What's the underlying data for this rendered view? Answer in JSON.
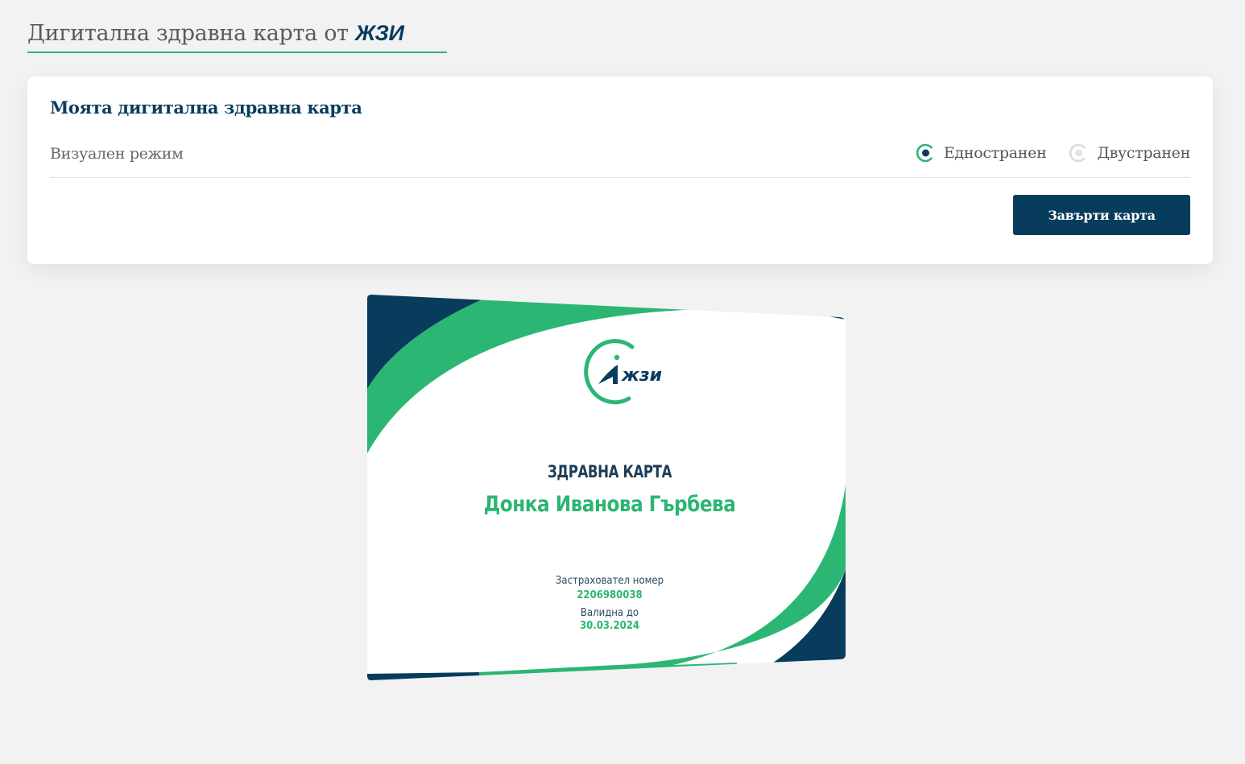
{
  "header": {
    "title": "Дигитална здравна карта от",
    "brand": "ЖЗИ"
  },
  "panel": {
    "title": "Моята дигитална здравна карта",
    "mode_label": "Визуален режим",
    "options": [
      {
        "label": "Едностранен",
        "selected": true
      },
      {
        "label": "Двустранен",
        "selected": false
      }
    ],
    "rotate_button": "Завърти карта"
  },
  "card": {
    "logo_text": "жзи",
    "title": "ЗДРАВНА КАРТА",
    "holder_name": "Донка Иванова Гърбева",
    "insurance_label": "Застраховател номер",
    "insurance_number": "2206980038",
    "valid_label": "Валидна до",
    "valid_date": "30.03.2024"
  },
  "colors": {
    "navy": "#083c5c",
    "green": "#2bb673",
    "background": "#f2f2f2"
  }
}
